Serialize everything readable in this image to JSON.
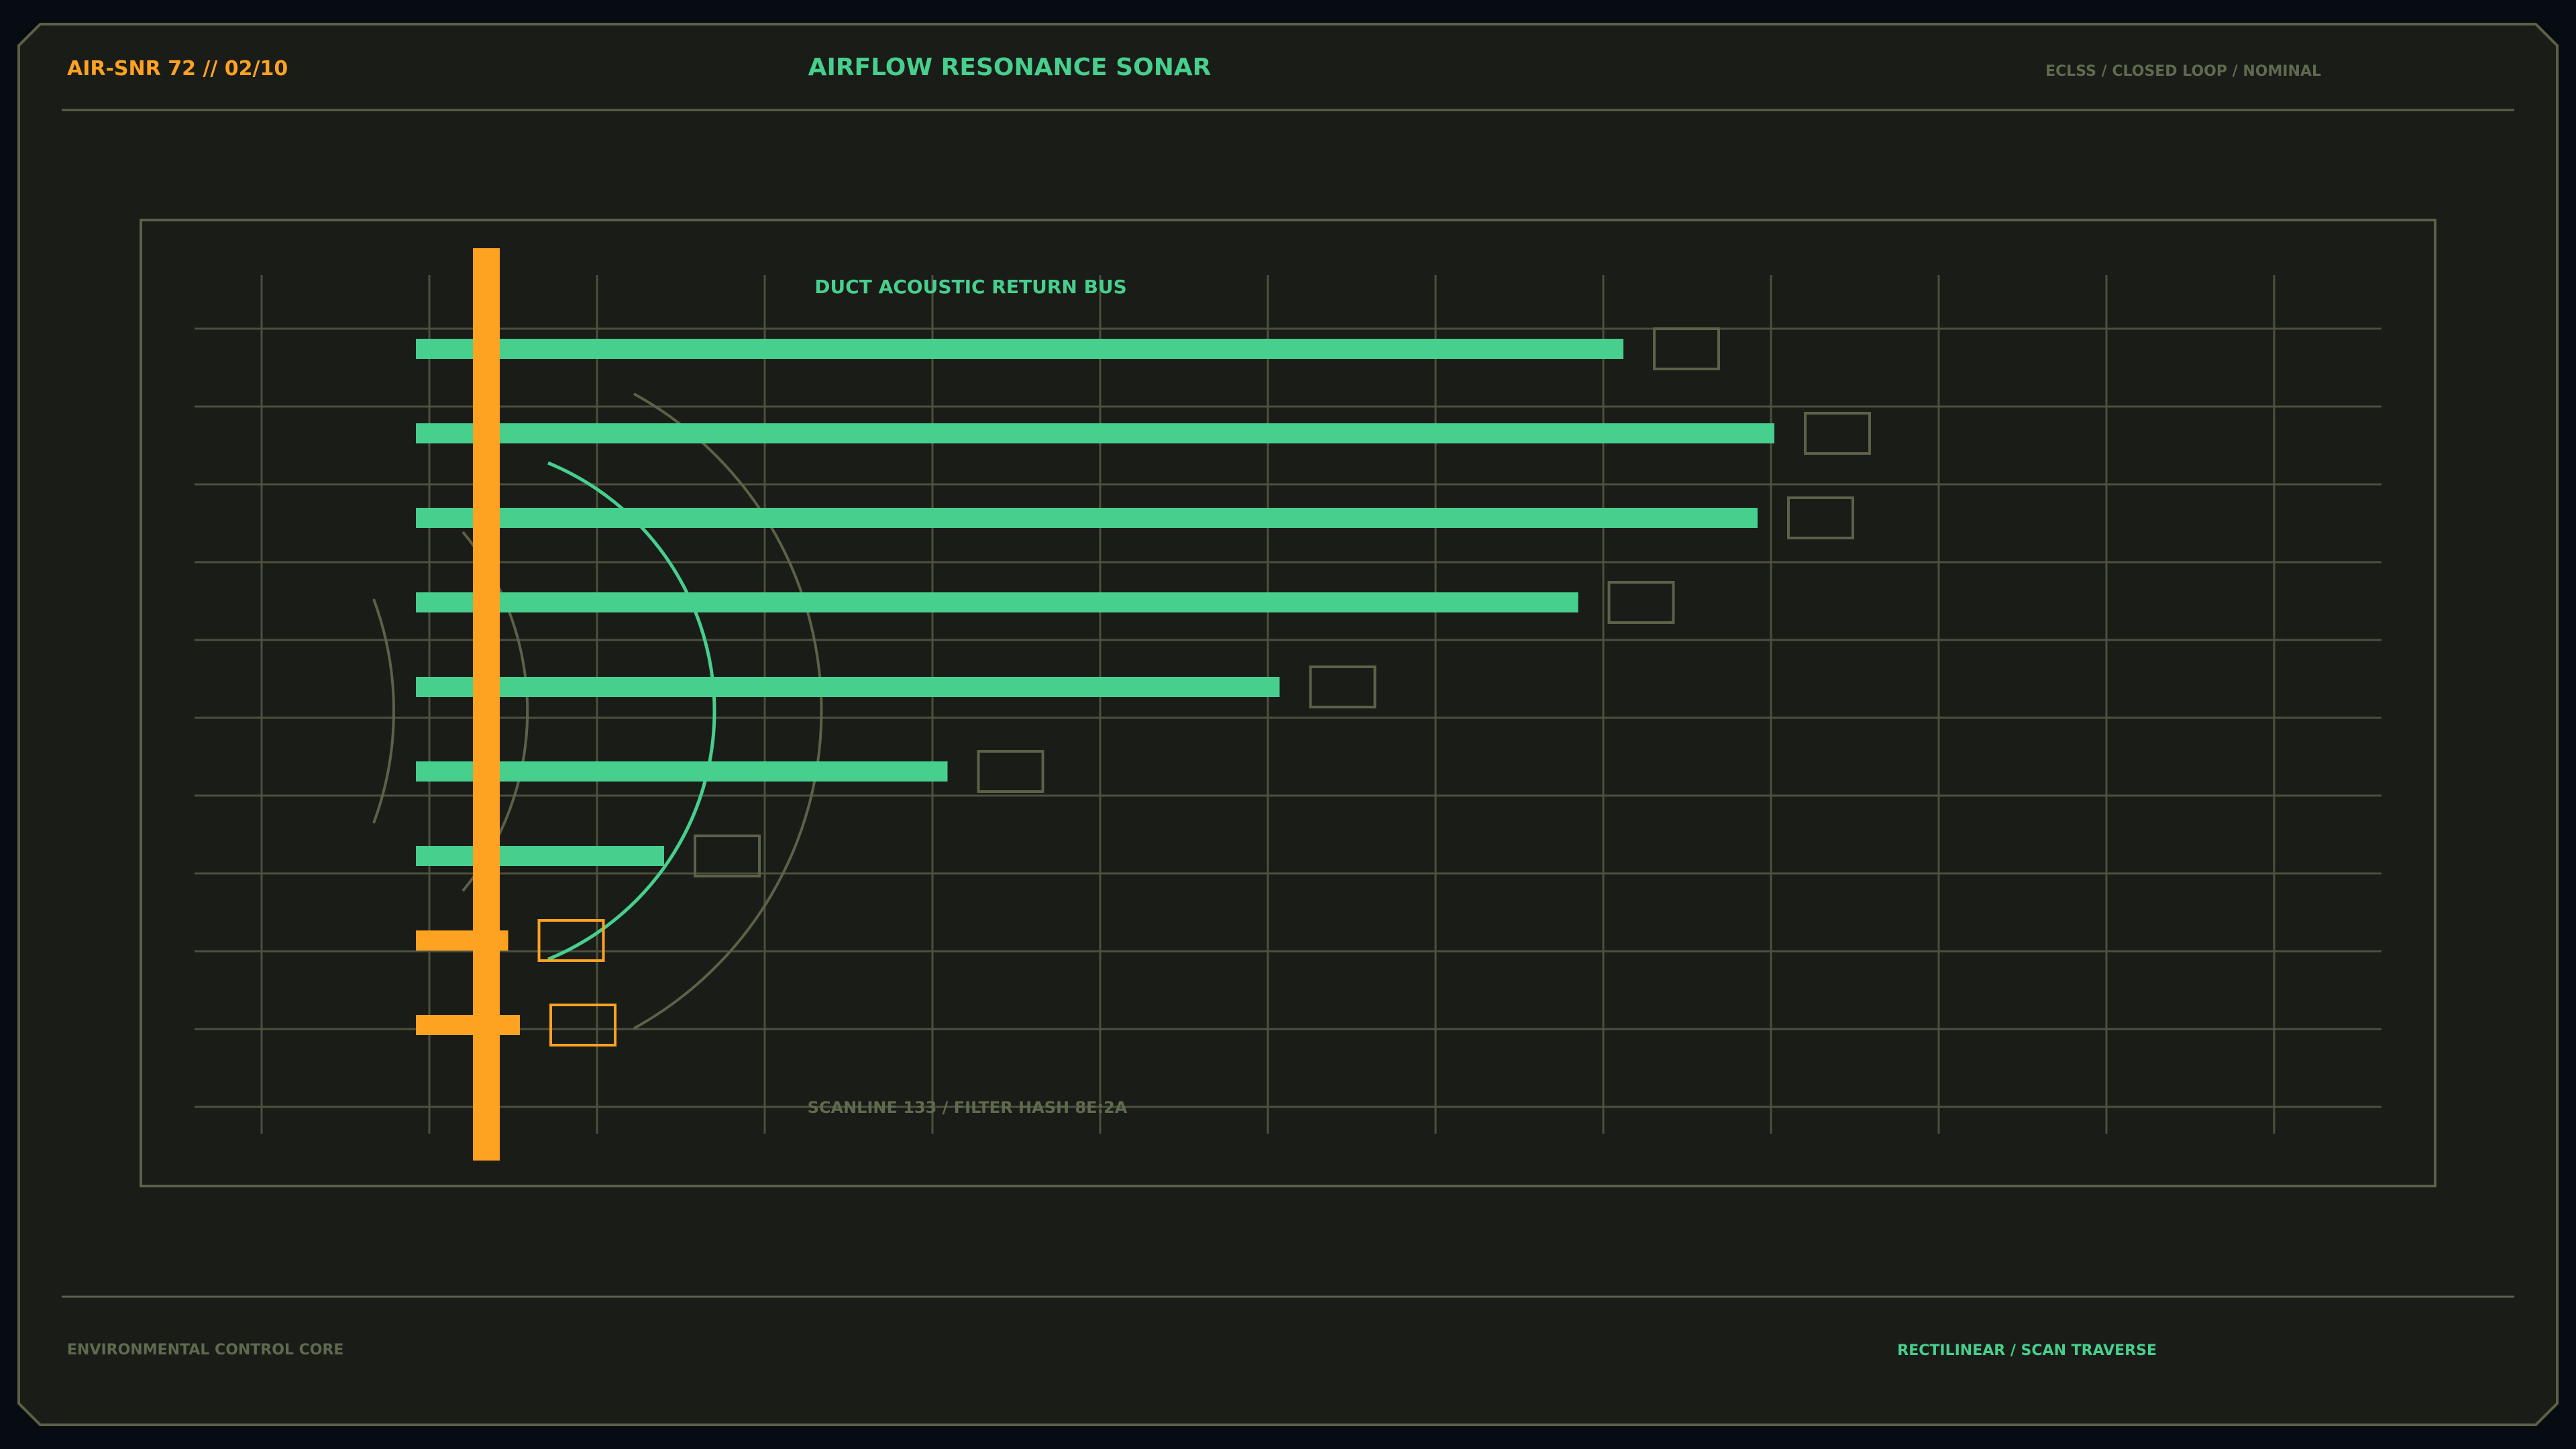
{
  "header": {
    "id_label": "AIR-SNR 72 // 02/10",
    "title": "AIRFLOW RESONANCE SONAR",
    "status": "ECLSS / CLOSED LOOP / NOMINAL"
  },
  "footer": {
    "left_label": "ENVIRONMENTAL CONTROL CORE",
    "right_label": "RECTILINEAR / SCAN TRAVERSE"
  },
  "colors": {
    "background": "#070c12",
    "panel": "#1a1c18",
    "frame_line": "#5c6148",
    "grid": "#4c503c",
    "accent_green": "#47cf8e",
    "accent_orange": "#fea222",
    "muted_text": "#5f6a4e"
  },
  "chart_data": {
    "type": "bar",
    "orientation": "horizontal",
    "title": "DUCT ACOUSTIC RETURN BUS",
    "footnote": "SCANLINE 133 / FILTER HASH 8E:2A",
    "xlim": [
      0,
      12
    ],
    "grid": true,
    "values": [
      7.2,
      8.1,
      8.0,
      6.93,
      5.15,
      3.17,
      1.48,
      0.55,
      0.62
    ],
    "status": [
      "nominal",
      "nominal",
      "nominal",
      "nominal",
      "nominal",
      "nominal",
      "nominal",
      "alert",
      "alert"
    ]
  }
}
